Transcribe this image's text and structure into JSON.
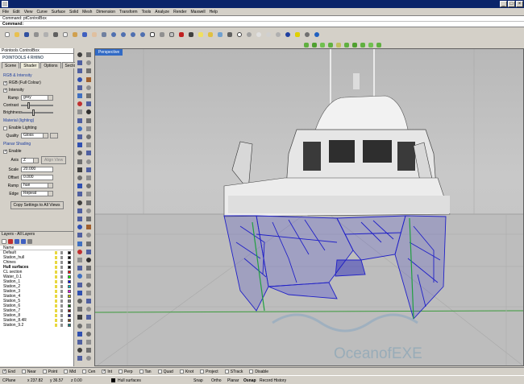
{
  "menu": [
    "File",
    "Edit",
    "View",
    "Curve",
    "Surface",
    "Solid",
    "Mesh",
    "Dimension",
    "Transform",
    "Tools",
    "Analyze",
    "Render",
    "Maxwell",
    "Help"
  ],
  "command": {
    "history": "Command: ptControlBox",
    "prompt": "Command:"
  },
  "panel": {
    "title": "Pointools ControlBox",
    "logo": "POINTOOLS 4 RHINO",
    "tabs": [
      "Scene",
      "Shader",
      "Options",
      "Sections"
    ],
    "active_tab": "Shader",
    "intensity_header": "RGB & Intensity",
    "rgb_label": "RGB (Full Colour)",
    "intensity_label": "Intensity",
    "ramp_label": "Ramp",
    "ramp_value": "grey",
    "contrast_label": "Contrast",
    "brightness_label": "Brightness",
    "material_header": "Material (lighting)",
    "enable_lighting_label": "Enable Lighting",
    "quality_label": "Quality",
    "quality_value": "Gloss",
    "planar_header": "Planar Shading",
    "enable_label": "Enable",
    "axis_label": "Axis",
    "axis_value": "Z",
    "align_button": "Align View",
    "scale_label": "Scale",
    "scale_value": "20.000",
    "offset_label": "Offset",
    "offset_value": "0.000",
    "ramp2_label": "Ramp",
    "ramp2_value": "hue",
    "edge_label": "Edge",
    "edge_value": "Repeat",
    "copy_button": "Copy Settings to All Views"
  },
  "layers": {
    "title": "Layers - All Layers",
    "column": "Name",
    "rows": [
      {
        "name": "Default",
        "color": "#000000"
      },
      {
        "name": "Station_hull",
        "color": "#000000"
      },
      {
        "name": "Chines",
        "color": "#000000"
      },
      {
        "name": "Hull surfaces",
        "color": "#000000",
        "current": true
      },
      {
        "name": "CL section",
        "color": "#ff0000"
      },
      {
        "name": "Water_0.1",
        "color": "#00ff00"
      },
      {
        "name": "Station_1",
        "color": "#0000ff"
      },
      {
        "name": "Station_2",
        "color": "#00c0c0"
      },
      {
        "name": "Station_3",
        "color": "#ff00ff"
      },
      {
        "name": "Station_4",
        "color": "#c0c000"
      },
      {
        "name": "Station_5",
        "color": "#808080"
      },
      {
        "name": "Station_6",
        "color": "#008000"
      },
      {
        "name": "Station_7",
        "color": "#800000"
      },
      {
        "name": "Station_8",
        "color": "#000080"
      },
      {
        "name": "Station_8.4R",
        "color": "#804000"
      },
      {
        "name": "Station_9.2",
        "color": "#008080"
      }
    ]
  },
  "viewport": {
    "title": "Perspective",
    "watermark": "OceanofEXE"
  },
  "osnaps": [
    "End",
    "Near",
    "Point",
    "Mid",
    "Cen",
    "Int",
    "Perp",
    "Tan",
    "Quad",
    "Knot",
    "Project",
    "STrack",
    "Disable"
  ],
  "status": {
    "cplane": "CPlane",
    "x": "x 237.82",
    "y": "y 36.57",
    "z": "z 0.00",
    "layer": "Hull surfaces",
    "items": [
      "Snap",
      "Ortho",
      "Planar",
      "Osnap",
      "Record History"
    ]
  }
}
